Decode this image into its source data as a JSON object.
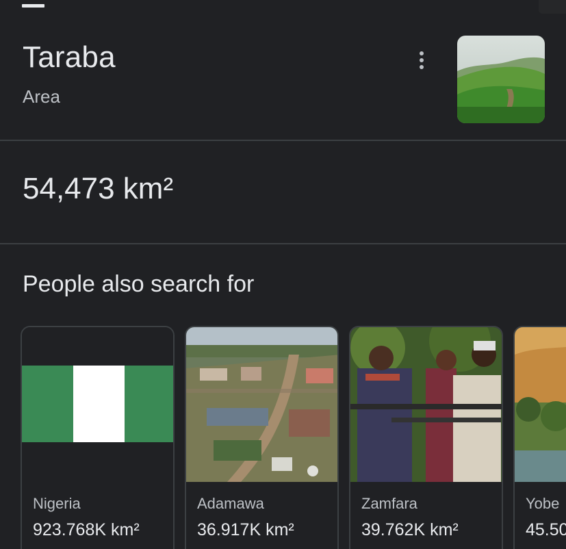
{
  "header": {
    "title": "Taraba",
    "subtitle": "Area",
    "more_icon": "more-vert-icon",
    "thumbnail": "green-hills-landscape"
  },
  "answer": {
    "value": "54,473 km²"
  },
  "people_also_search": {
    "heading": "People also search for",
    "items": [
      {
        "name": "Nigeria",
        "value": "923.768K km²",
        "image": "nigeria-flag"
      },
      {
        "name": "Adamawa",
        "value": "36.917K km²",
        "image": "town-aerial-photo"
      },
      {
        "name": "Zamfara",
        "value": "39.762K km²",
        "image": "armed-group-photo"
      },
      {
        "name": "Yobe",
        "value": "45.50",
        "image": "desert-oasis-photo"
      }
    ]
  },
  "colors": {
    "background": "#202124",
    "divider": "#3c4043",
    "text_primary": "#e8eaed",
    "text_secondary": "#bdc1c6",
    "flag_green": "#3a8a55"
  }
}
